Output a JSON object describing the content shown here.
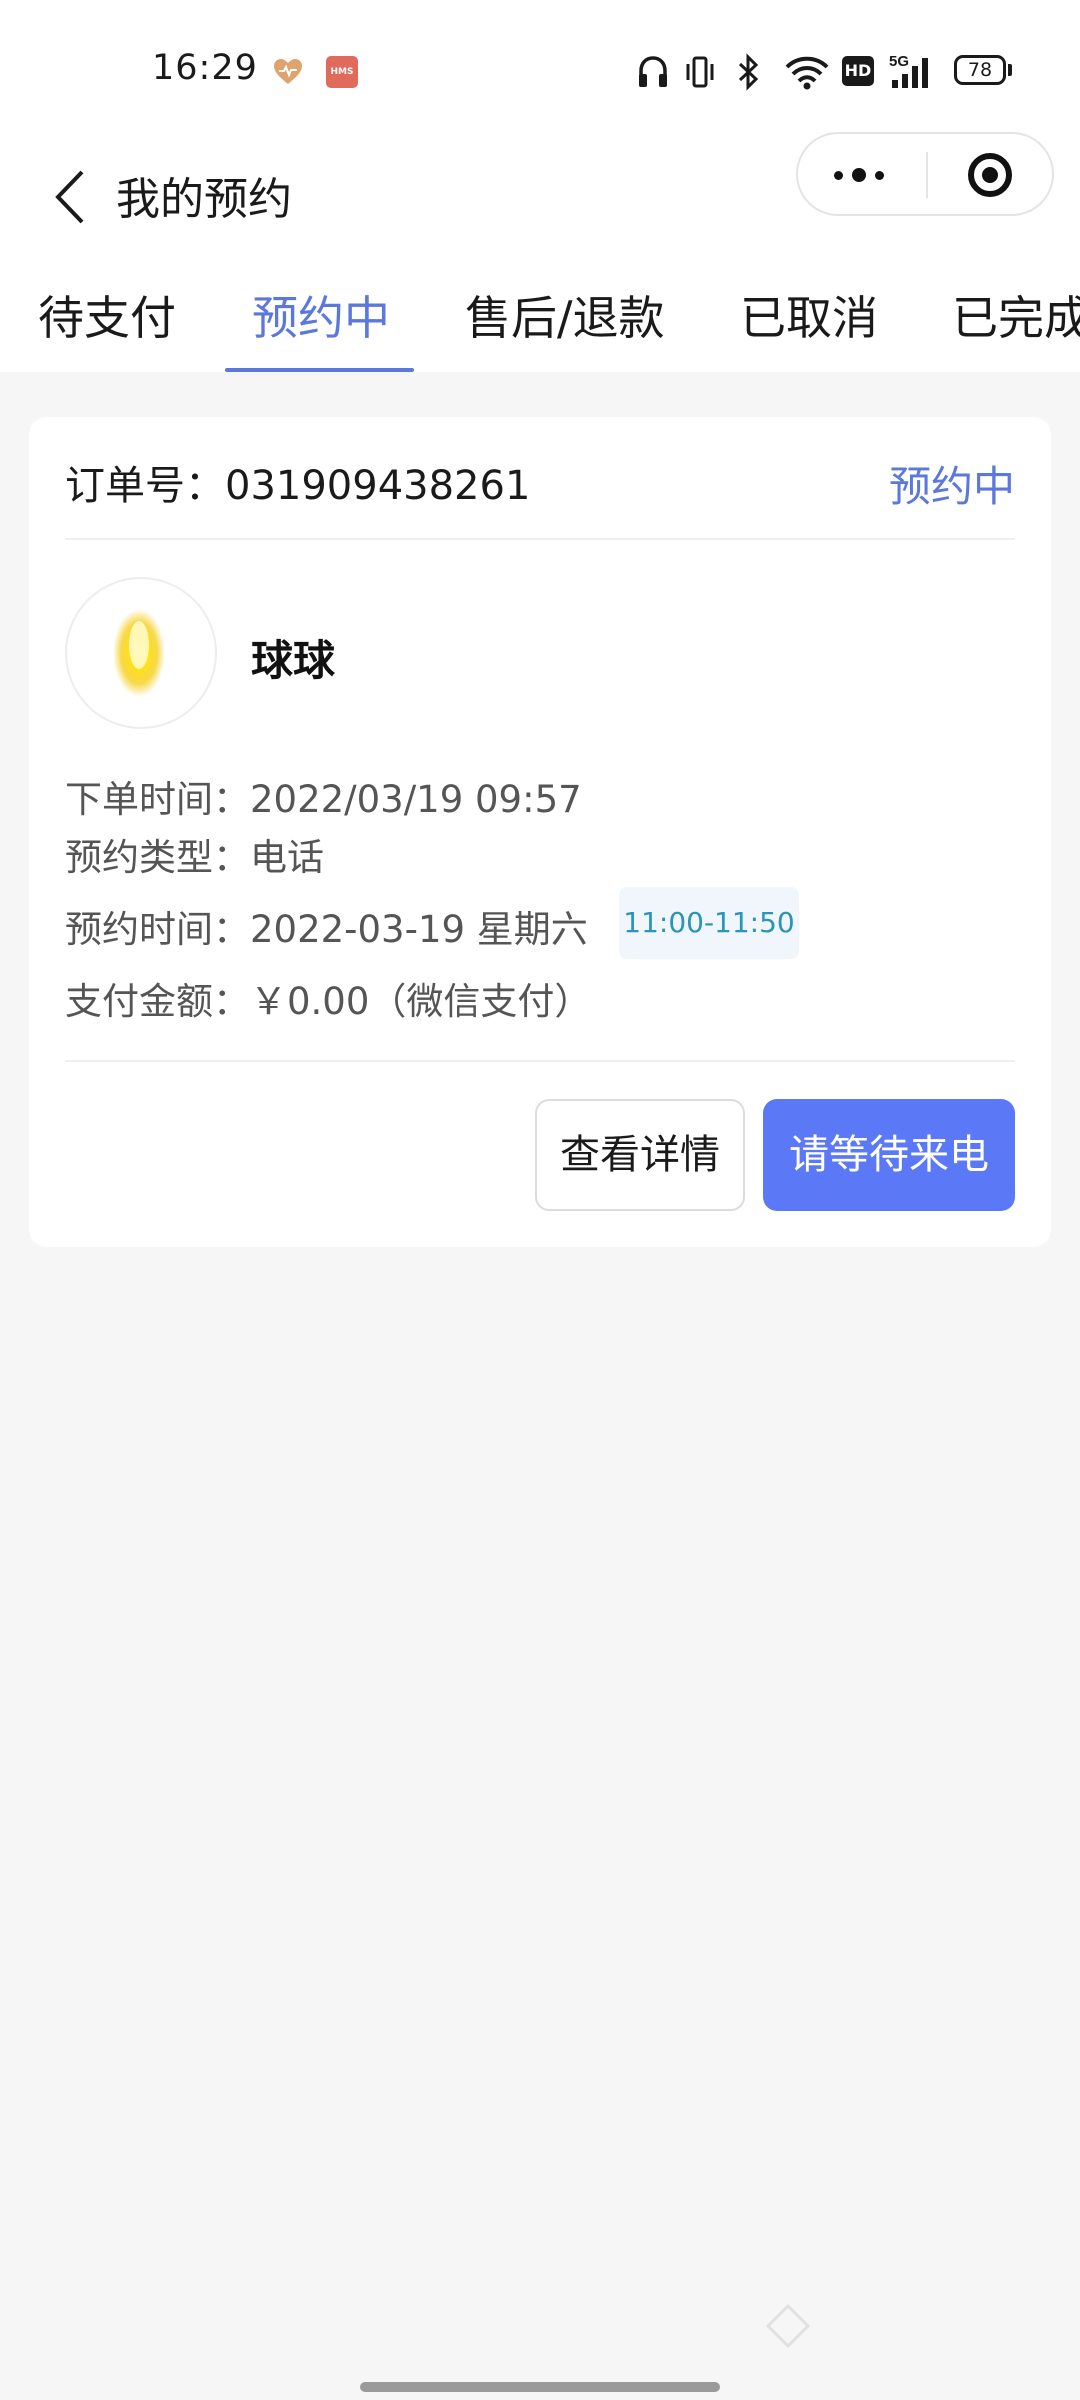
{
  "status_bar": {
    "time": "16:29",
    "hms_label": "HMS",
    "hd_label": "HD",
    "network_label": "5G",
    "battery": "78",
    "icons": [
      "heart-health-icon",
      "hms-icon",
      "headphones-icon",
      "vibrate-icon",
      "bluetooth-icon",
      "wifi-icon",
      "hd-icon",
      "signal-5g-icon",
      "battery-icon"
    ]
  },
  "header": {
    "title": "我的预约",
    "back_icon": "chevron-left-icon",
    "more_icon": "more-dots-icon",
    "close_icon": "target-circle-icon"
  },
  "tabs": [
    {
      "label": "待支付",
      "active": false
    },
    {
      "label": "预约中",
      "active": true
    },
    {
      "label": "售后/退款",
      "active": false
    },
    {
      "label": "已取消",
      "active": false
    },
    {
      "label": "已完成",
      "active": false
    }
  ],
  "order": {
    "number_label": "订单号：",
    "number": "031909438261",
    "status": "预约中",
    "user_name": "球球",
    "avatar_icon": "flame-avatar-icon",
    "order_time_label": "下单时间：",
    "order_time": "2022/03/19 09:57",
    "type_label": "预约类型：",
    "type": "电话",
    "appt_time_label": "预约时间：",
    "appt_date": "2022-03-19 星期六",
    "appt_slot": "11:00-11:50",
    "amount_label": "支付金额：",
    "amount": "￥0.00（微信支付）",
    "detail_button": "查看详情",
    "wait_button": "请等待来电"
  },
  "colors": {
    "accent": "#5b78dd",
    "primary_button": "#5b78f7",
    "slot_text": "#2a96b5",
    "page_bg": "#f6f6f7"
  }
}
